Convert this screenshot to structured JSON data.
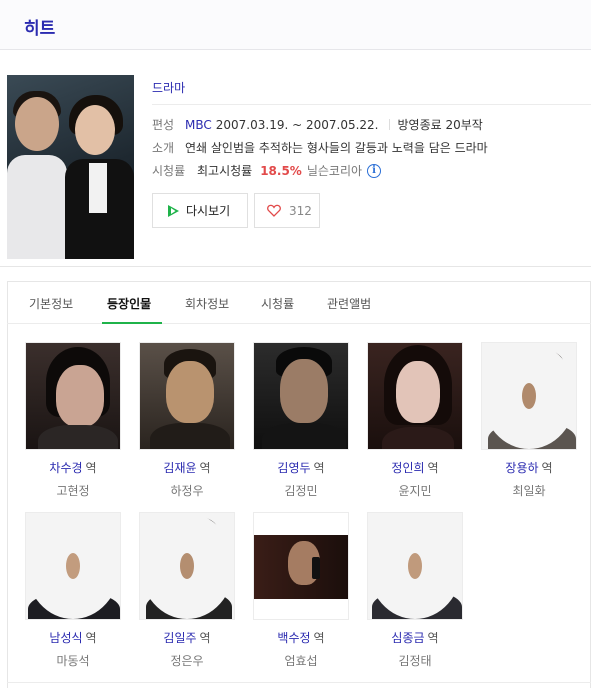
{
  "title": "히트",
  "genre": "드라마",
  "info": {
    "broadcast_label": "편성",
    "channel": "MBC",
    "period": "2007.03.19. ~ 2007.05.22.",
    "status": "방영종료 20부작",
    "intro_label": "소개",
    "intro": "연쇄 살인범을 추적하는 형사들의 갈등과 노력을 담은 드라마",
    "rating_label": "시청률",
    "rating_prefix": "최고시청률",
    "rating_value": "18.5%",
    "rating_source": "닐슨코리아",
    "info_icon_glyph": "i"
  },
  "buttons": {
    "replay_label": "다시보기",
    "like_count": "312"
  },
  "tabs": [
    {
      "label": "기본정보"
    },
    {
      "label": "등장인물"
    },
    {
      "label": "회차정보"
    },
    {
      "label": "시청률"
    },
    {
      "label": "관련앨범"
    }
  ],
  "active_tab": "등장인물",
  "role_suffix": "역",
  "cast": [
    {
      "role": "차수경",
      "actor": "고현정"
    },
    {
      "role": "김재윤",
      "actor": "하정우"
    },
    {
      "role": "김영두",
      "actor": "김정민"
    },
    {
      "role": "정인희",
      "actor": "윤지민"
    },
    {
      "role": "장용하",
      "actor": "최일화"
    },
    {
      "role": "남성식",
      "actor": "마동석"
    },
    {
      "role": "김일주",
      "actor": "정은우"
    },
    {
      "role": "백수정",
      "actor": "엄효섭"
    },
    {
      "role": "심종금",
      "actor": "김정태"
    }
  ],
  "colors": {
    "accent_blue": "#2b2bb0",
    "rating_red": "#e24a4a",
    "tab_active_green": "#1fb34a"
  }
}
